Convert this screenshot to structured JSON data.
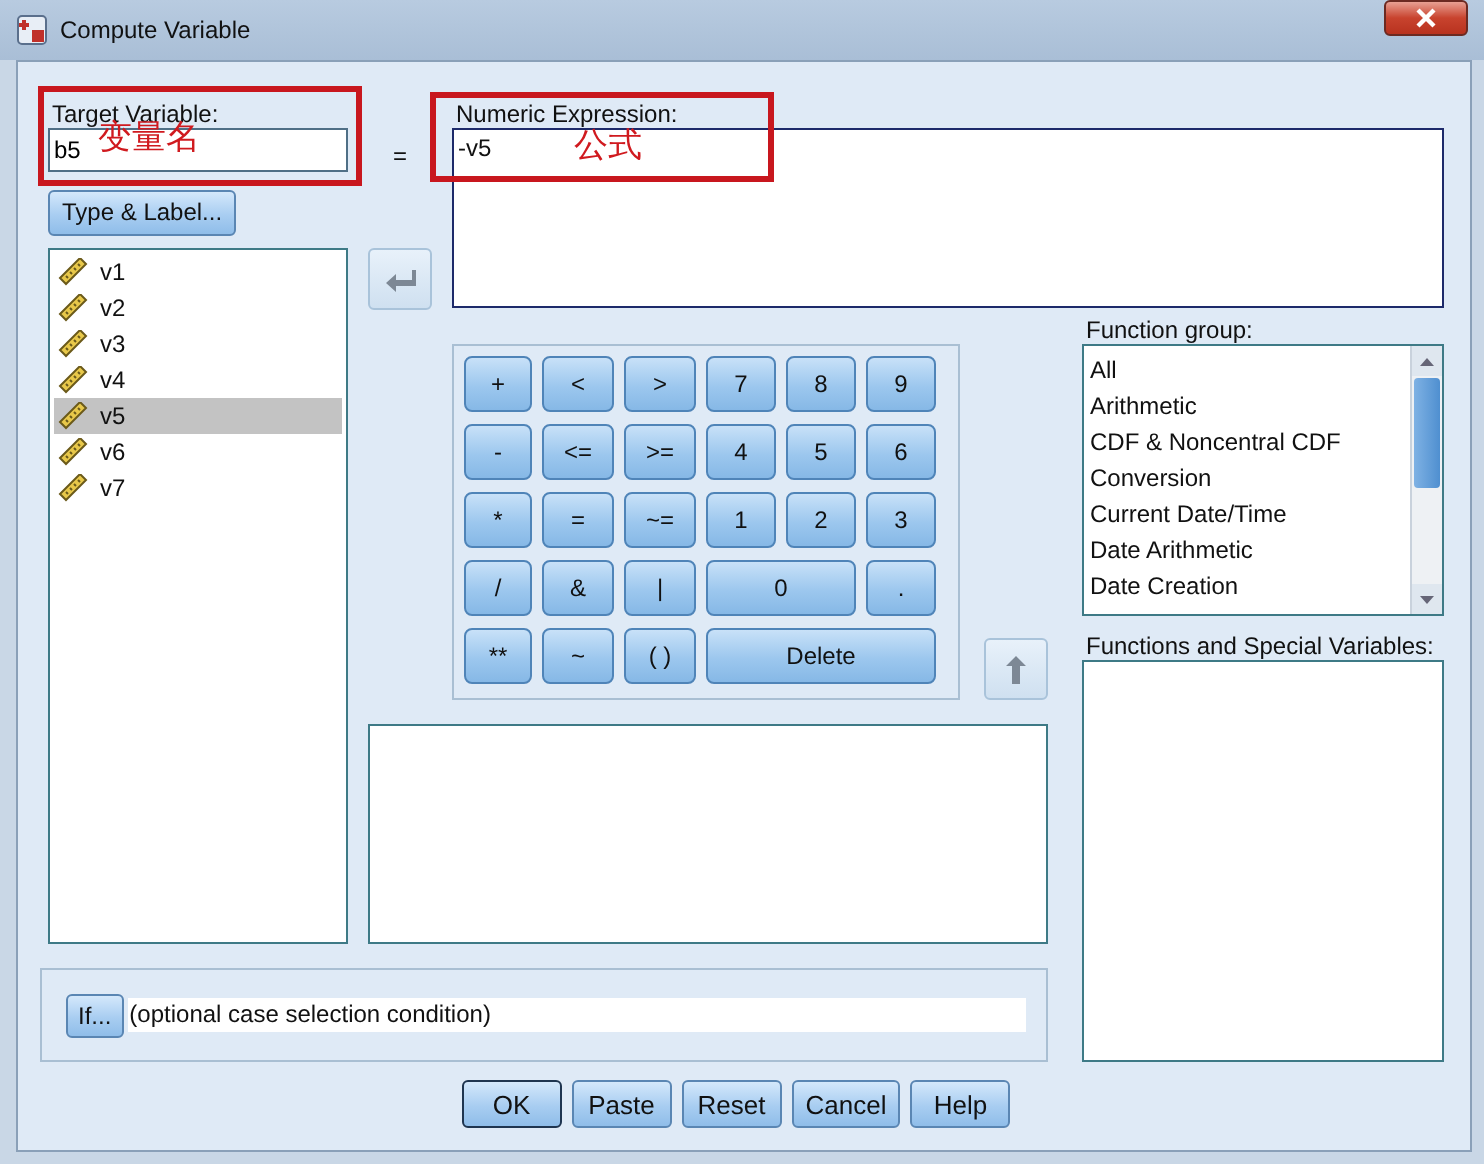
{
  "window": {
    "title": "Compute Variable"
  },
  "target_variable": {
    "label": "Target Variable:",
    "value": "b5"
  },
  "equals": "=",
  "type_label_button": "Type & Label...",
  "numeric_expression": {
    "label": "Numeric Expression:",
    "value": "-v5"
  },
  "variables": [
    {
      "name": "v1",
      "selected": false
    },
    {
      "name": "v2",
      "selected": false
    },
    {
      "name": "v3",
      "selected": false
    },
    {
      "name": "v4",
      "selected": false
    },
    {
      "name": "v5",
      "selected": true
    },
    {
      "name": "v6",
      "selected": false
    },
    {
      "name": "v7",
      "selected": false
    }
  ],
  "keypad": [
    {
      "label": "+",
      "kind": "key"
    },
    {
      "label": "<",
      "kind": "key"
    },
    {
      "label": ">",
      "kind": "key"
    },
    {
      "label": "7",
      "kind": "key"
    },
    {
      "label": "8",
      "kind": "key"
    },
    {
      "label": "9",
      "kind": "key"
    },
    {
      "label": "-",
      "kind": "key"
    },
    {
      "label": "<=",
      "kind": "key"
    },
    {
      "label": ">=",
      "kind": "key"
    },
    {
      "label": "4",
      "kind": "key"
    },
    {
      "label": "5",
      "kind": "key"
    },
    {
      "label": "6",
      "kind": "key"
    },
    {
      "label": "*",
      "kind": "key"
    },
    {
      "label": "=",
      "kind": "key"
    },
    {
      "label": "~=",
      "kind": "key"
    },
    {
      "label": "1",
      "kind": "key"
    },
    {
      "label": "2",
      "kind": "key"
    },
    {
      "label": "3",
      "kind": "key"
    },
    {
      "label": "/",
      "kind": "key"
    },
    {
      "label": "&",
      "kind": "key"
    },
    {
      "label": "|",
      "kind": "key"
    },
    {
      "label": "0",
      "kind": "double"
    },
    {
      "label": ".",
      "kind": "key"
    },
    {
      "label": "**",
      "kind": "key"
    },
    {
      "label": "~",
      "kind": "key"
    },
    {
      "label": "( )",
      "kind": "key"
    },
    {
      "label": "Delete",
      "kind": "triple"
    }
  ],
  "function_group": {
    "label": "Function group:",
    "items": [
      {
        "name": "All",
        "selected": false
      },
      {
        "name": "Arithmetic",
        "selected": false
      },
      {
        "name": "CDF & Noncentral CDF",
        "selected": false
      },
      {
        "name": "Conversion",
        "selected": false
      },
      {
        "name": "Current Date/Time",
        "selected": false
      },
      {
        "name": "Date Arithmetic",
        "selected": false
      },
      {
        "name": "Date Creation",
        "selected": false
      }
    ]
  },
  "functions_label": "Functions and Special Variables:",
  "if_button": "If...",
  "if_condition": "(optional case selection condition)",
  "buttons": [
    "OK",
    "Paste",
    "Reset",
    "Cancel",
    "Help"
  ],
  "annotations": [
    {
      "text": "变量名"
    },
    {
      "text": "公式"
    }
  ]
}
